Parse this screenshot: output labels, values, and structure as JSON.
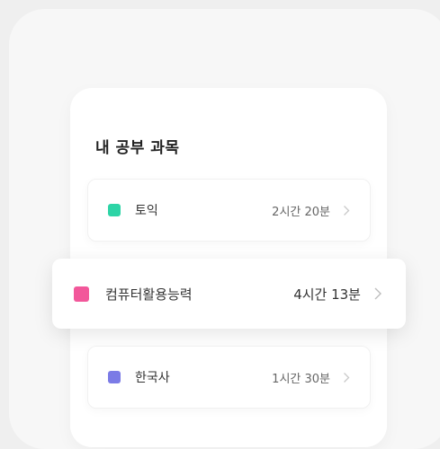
{
  "panel": {
    "title": "내 공부 과목"
  },
  "subjects": [
    {
      "name": "토익",
      "time": "2시간 20분",
      "color": "#2dd4a6",
      "icon": "chevron-right-icon"
    },
    {
      "name": "컴퓨터활용능력",
      "time": "4시간 13분",
      "color": "#f2579a",
      "icon": "chevron-right-icon"
    },
    {
      "name": "한국사",
      "time": "1시간 30분",
      "color": "#7b7be6",
      "icon": "chevron-right-icon"
    }
  ]
}
